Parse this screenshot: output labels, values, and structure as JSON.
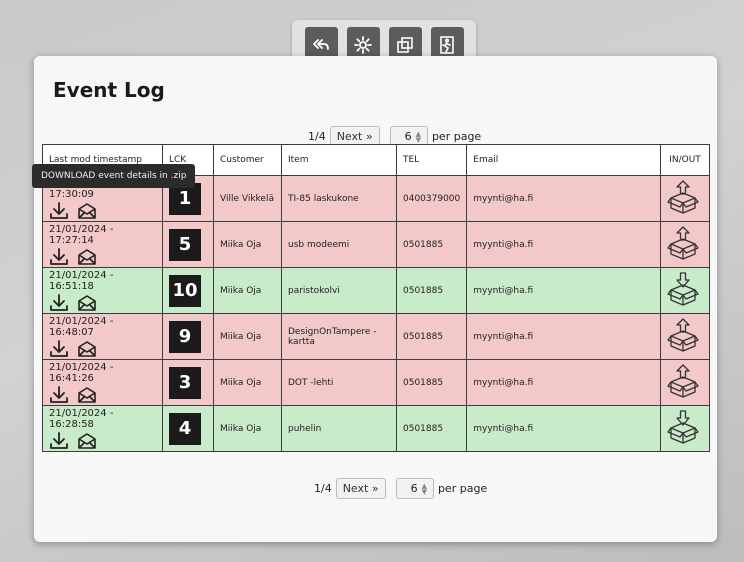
{
  "toolbar": {
    "buttons": [
      {
        "name": "back-button",
        "icon": "double-back-arrow-icon"
      },
      {
        "name": "settings-button",
        "icon": "gear-icon"
      },
      {
        "name": "copy-button",
        "icon": "copy-icon"
      },
      {
        "name": "exit-button",
        "icon": "exit-door-icon"
      }
    ]
  },
  "page": {
    "title": "Event Log"
  },
  "pagination": {
    "current": "1/4",
    "next_label": "Next »",
    "per_page_value": "6",
    "per_page_label": "per page"
  },
  "table": {
    "headers": [
      "Last mod timestamp",
      "LCK",
      "Customer",
      "Item",
      "TEL",
      "Email",
      "IN/OUT"
    ],
    "rows": [
      {
        "timestamp": "21/01/2024 - 17:30:09",
        "lck": "1",
        "customer": "Ville Vikkelä",
        "item": "TI-85 laskukone",
        "tel": "0400379000",
        "email": "myynti@ha.fi",
        "direction": "out"
      },
      {
        "timestamp": "21/01/2024 - 17:27:14",
        "lck": "5",
        "customer": "Miika Oja",
        "item": "usb modeemi",
        "tel": "0501885",
        "email": "myynti@ha.fi",
        "direction": "out"
      },
      {
        "timestamp": "21/01/2024 - 16:51:18",
        "lck": "10",
        "customer": "Miika Oja",
        "item": "paristokolvi",
        "tel": "0501885",
        "email": "myynti@ha.fi",
        "direction": "in"
      },
      {
        "timestamp": "21/01/2024 - 16:48:07",
        "lck": "9",
        "customer": "Miika Oja",
        "item": "DesignOnTampere -kartta",
        "tel": "0501885",
        "email": "myynti@ha.fi",
        "direction": "out"
      },
      {
        "timestamp": "21/01/2024 - 16:41:26",
        "lck": "3",
        "customer": "Miika Oja",
        "item": "DOT -lehti",
        "tel": "0501885",
        "email": "myynti@ha.fi",
        "direction": "out"
      },
      {
        "timestamp": "21/01/2024 - 16:28:58",
        "lck": "4",
        "customer": "Miika Oja",
        "item": "puhelin",
        "tel": "0501885",
        "email": "myynti@ha.fi",
        "direction": "in"
      }
    ]
  },
  "tooltip": {
    "text": "DOWNLOAD event details in .zip"
  },
  "colors": {
    "out_row": "#f2c8c8",
    "in_row": "#c8ebc9",
    "lck_box": "#1b1b1b",
    "toolbar_button": "#5c5c5c"
  }
}
